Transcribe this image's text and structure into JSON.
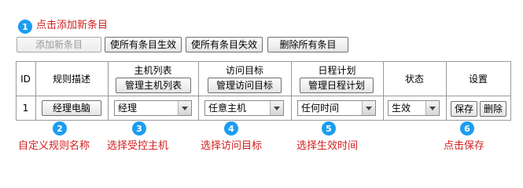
{
  "annotations": {
    "top": "点击添加新条目",
    "bottom": [
      "自定义规则名称",
      "选择受控主机",
      "选择访问目标",
      "选择生效时间",
      "点击保存"
    ]
  },
  "badges": [
    "1",
    "2",
    "3",
    "4",
    "5",
    "6"
  ],
  "toolbar": {
    "add_label": "添加新条目",
    "enable_all_label": "使所有条目生效",
    "disable_all_label": "使所有条目失效",
    "delete_all_label": "删除所有条目"
  },
  "table": {
    "headers": {
      "id": "ID",
      "rule_desc": "规则描述",
      "host_list": "主机列表",
      "host_list_button": "管理主机列表",
      "target": "访问目标",
      "target_button": "管理访问目标",
      "schedule": "日程计划",
      "schedule_button": "管理日程计划",
      "status": "状态",
      "settings": "设置"
    },
    "row": {
      "id": "1",
      "rule_name": "经理电脑",
      "host": "经理",
      "target": "任意主机",
      "schedule": "任何时间",
      "status": "生效",
      "save_label": "保存",
      "delete_label": "删除"
    }
  },
  "colors": {
    "accent_badge": "#1c9df0",
    "annotation_text": "#d02020",
    "grid_line": "#999999"
  }
}
